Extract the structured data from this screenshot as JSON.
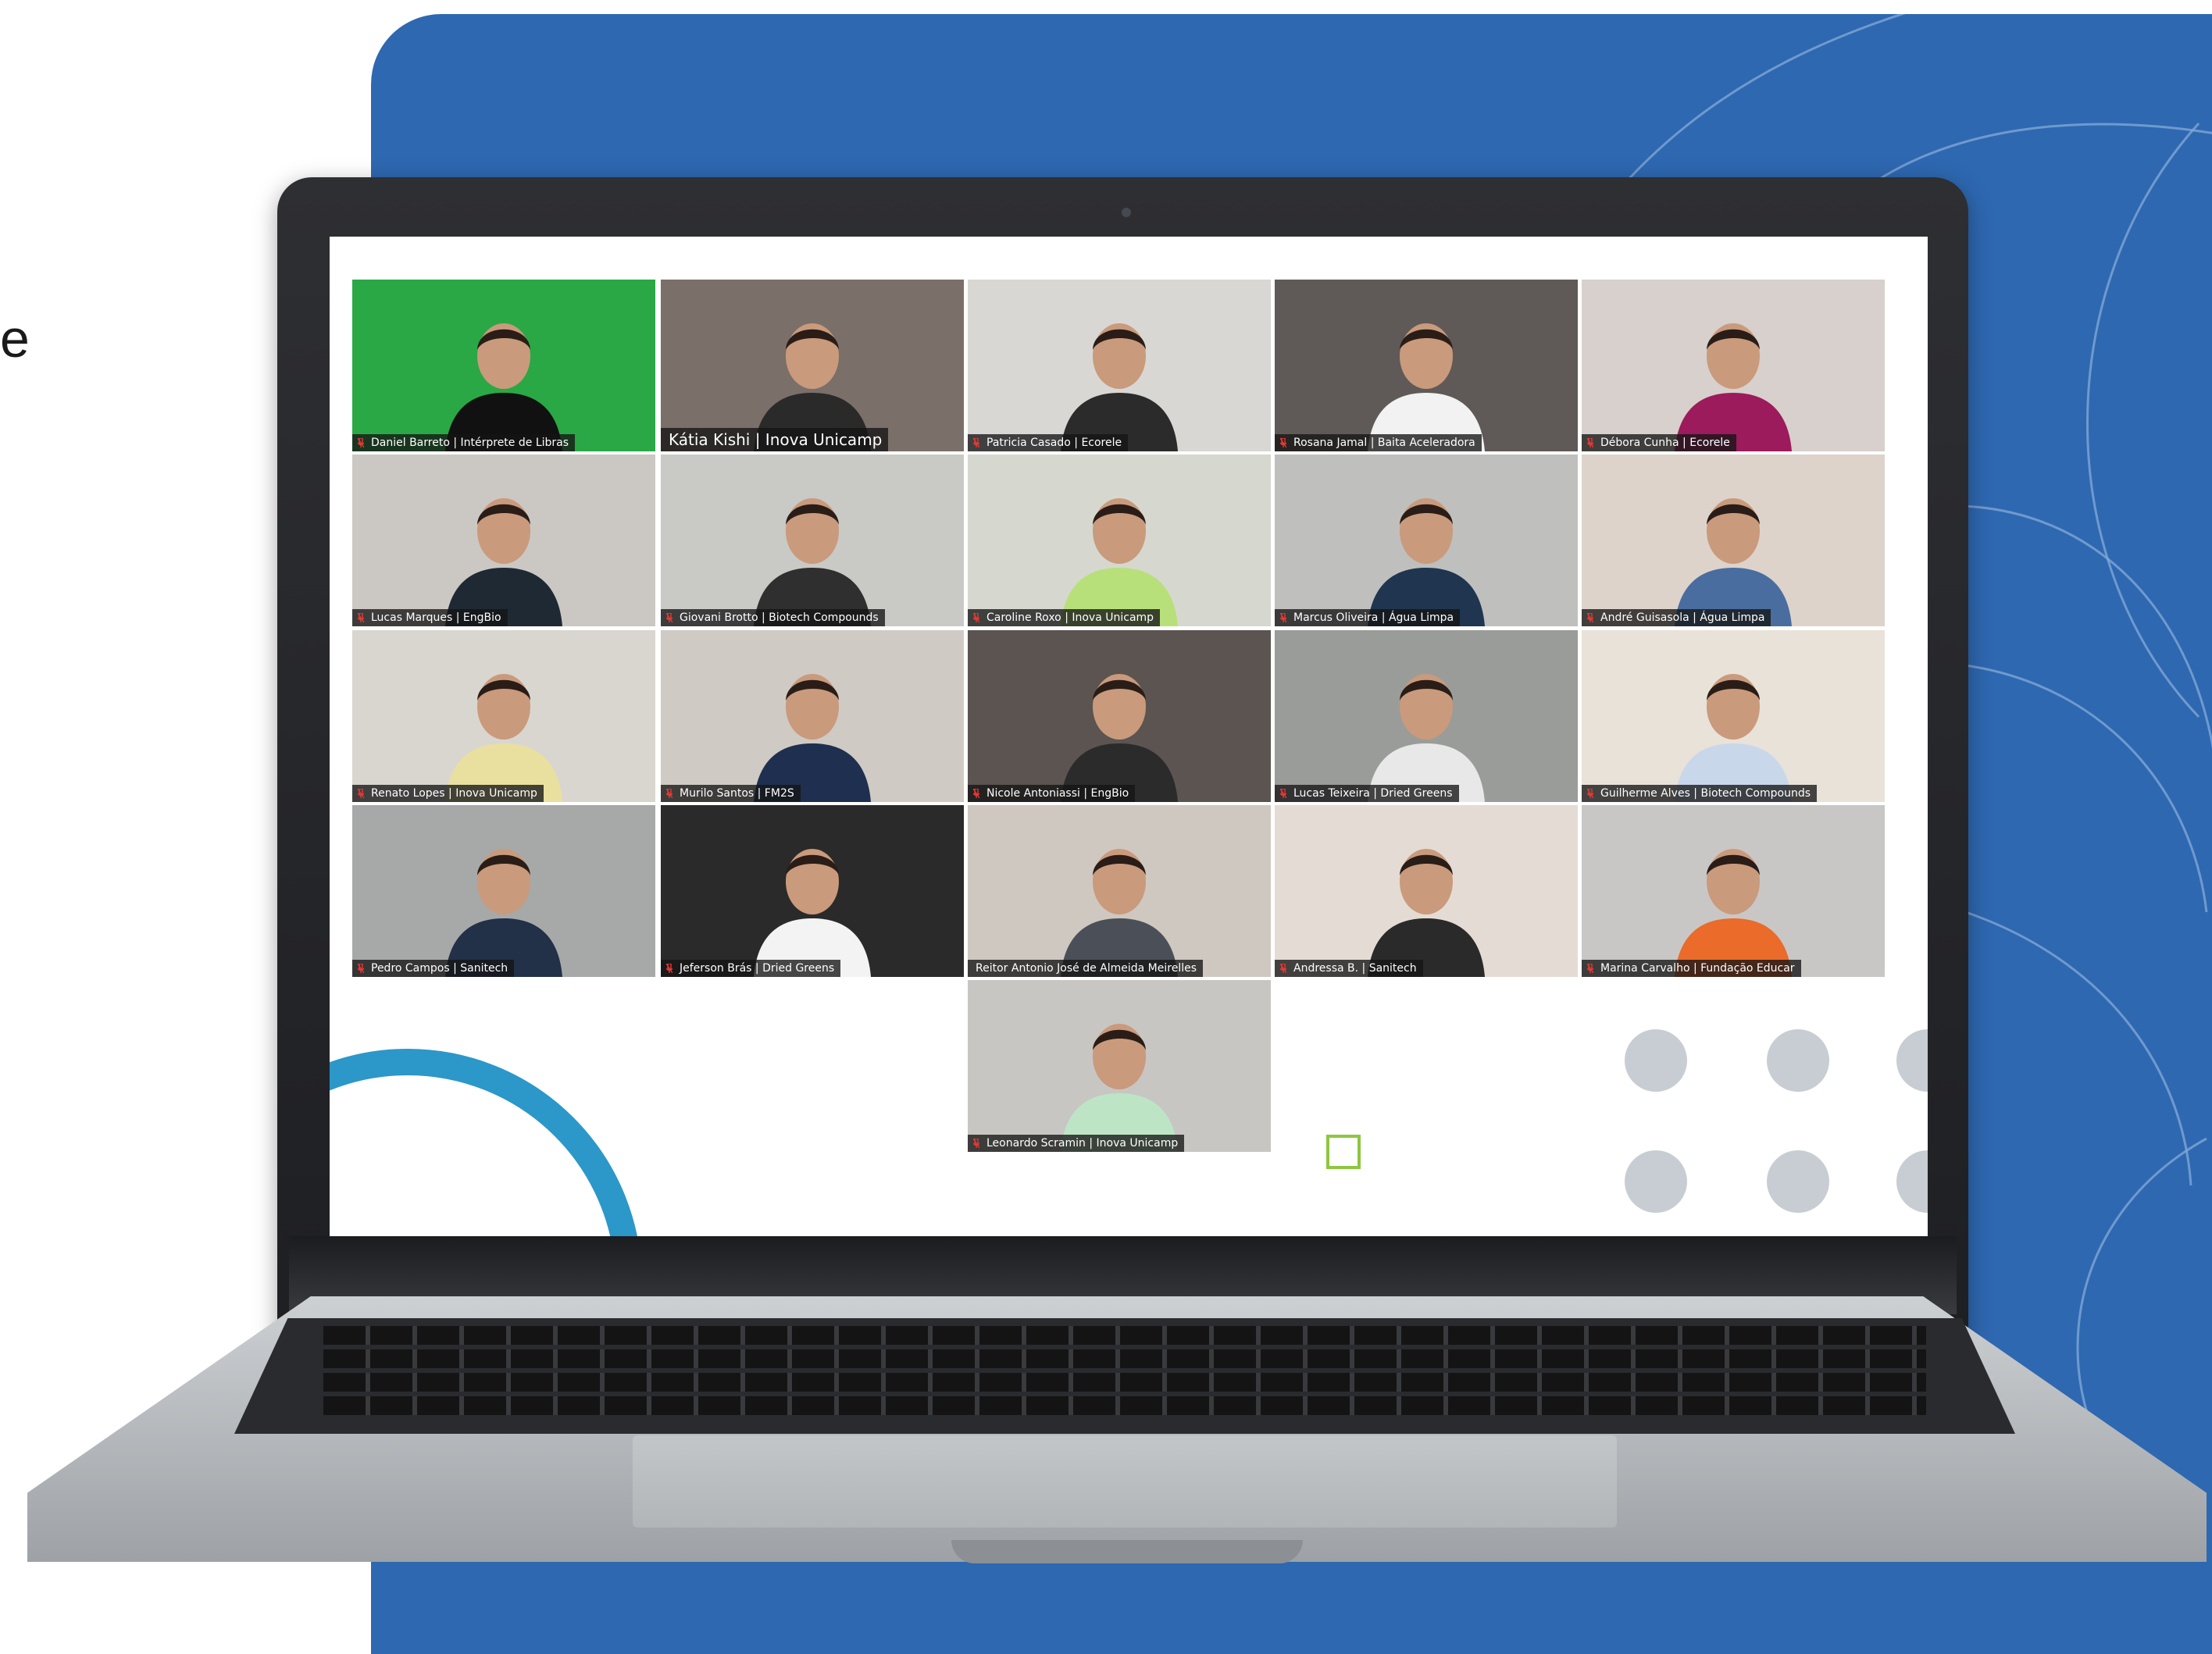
{
  "left_edge_text": "e",
  "colors": {
    "panel_blue": "#2e68b1",
    "deco_arc_blue": "#2c97c9",
    "deco_square_green": "#8ec641",
    "deco_dot_gray": "#c8cdd3",
    "active_speaker_border": "#53c25b"
  },
  "meeting": {
    "participants": [
      {
        "name": "Daniel Barreto | Intérprete de Libras"
      },
      {
        "name": "Kátia Kishi | Inova Unicamp"
      },
      {
        "name": "Patricia Casado | Ecorele"
      },
      {
        "name": "Rosana Jamal | Baita Aceleradora"
      },
      {
        "name": "Débora Cunha | Ecorele"
      },
      {
        "name": "Lucas Marques | EngBio"
      },
      {
        "name": "Giovani Brotto | Biotech Compounds"
      },
      {
        "name": "Caroline Roxo | Inova Unicamp"
      },
      {
        "name": "Marcus Oliveira | Água Limpa"
      },
      {
        "name": "André Guisasola | Água Limpa"
      },
      {
        "name": "Renato Lopes | Inova Unicamp"
      },
      {
        "name": "Murilo Santos | FM2S"
      },
      {
        "name": "Nicole Antoniassi | EngBio"
      },
      {
        "name": "Lucas Teixeira | Dried Greens"
      },
      {
        "name": "Guilherme Alves | Biotech Compounds"
      },
      {
        "name": "Pedro Campos | Sanitech"
      },
      {
        "name": "Jeferson Brás | Dried Greens"
      },
      {
        "name": "Reitor Antonio José de Almeida Meirelles"
      },
      {
        "name": "Andressa B. | Sanitech"
      },
      {
        "name": "Marina Carvalho | Fundação Educar"
      },
      {
        "name": "Leonardo Scramin | Inova Unicamp"
      }
    ]
  }
}
